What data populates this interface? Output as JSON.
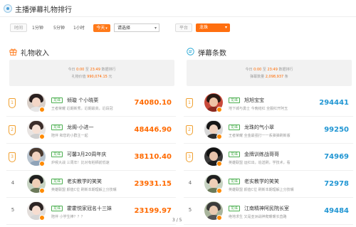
{
  "header": {
    "title": "主播弹幕礼物排行"
  },
  "filters": {
    "time_label": "时间",
    "time_options": [
      "1分钟",
      "5分钟",
      "1小时"
    ],
    "today_label": "今天",
    "select_placeholder": "请选择",
    "platform_label": "平台",
    "platform_value": "龙珠"
  },
  "gifts": {
    "title": "礼物收入",
    "summary_line1": {
      "prefix": "今日 ",
      "t1": "0:00",
      "mid": " 至 ",
      "t2": "23:49",
      "suffix": " 数据排行"
    },
    "summary_line2": {
      "prefix": "礼物价值 ",
      "value": "990,074.15",
      "suffix": " 元"
    },
    "rows": [
      {
        "rank": "1",
        "tag": "龙珠",
        "name": "倾璇 个小晓栗",
        "desc": "王者荣耀 近期新秀，近期最高，近段冠",
        "value": "74080.10"
      },
      {
        "rank": "2",
        "tag": "龙珠",
        "name": "龙阁-小进一",
        "desc": "陪伴 和您的小群主一起",
        "value": "48446.90"
      },
      {
        "rank": "3",
        "tag": "龙珠",
        "name": "可馨3月20周年庆",
        "desc": "炉候大战 三周年！比对有稻栖前低速",
        "value": "38110.40"
      },
      {
        "rank": "4",
        "tag": "龙珠",
        "name": "老实教学的笑笑",
        "desc": "英雄联盟 颜值C位 刷新本期理解上分技嘴",
        "value": "23931.15"
      },
      {
        "rank": "5",
        "tag": "龙珠",
        "name": "霍霍悦家冠名十三妹",
        "desc": "陪伴 小学生棒？？？",
        "value": "23199.97"
      }
    ]
  },
  "danmaku": {
    "title": "弹幕条数",
    "summary_line1": {
      "prefix": "今日 ",
      "t1": "0:00",
      "mid": " 至 ",
      "t2": "23:49",
      "suffix": " 数据排行"
    },
    "summary_line2": {
      "prefix": "弹幕数量 ",
      "value": "2,098,937",
      "suffix": " 条"
    },
    "rows": [
      {
        "rank": "1",
        "tag": "龙珠",
        "name": "旭旭宝宝",
        "desc": "地下城与勇士 今晚结红 全服红开阿玉",
        "value": "294441"
      },
      {
        "rank": "2",
        "tag": "龙珠",
        "name": "龙珠的气小翠",
        "desc": "王者荣耀 全金最强打一一系弹弹刷新版",
        "value": "99250"
      },
      {
        "rank": "3",
        "tag": "龙珠",
        "name": "金牌训练战哥哥",
        "desc": "英雄联盟 运红出，追送刷，学技术，看",
        "value": "74969"
      },
      {
        "rank": "4",
        "tag": "龙珠",
        "name": "老实教学的笑笑",
        "desc": "英雄联盟 颜值C位 刷新本期理解上分技嘴",
        "value": "72978"
      },
      {
        "rank": "5",
        "tag": "龙珠",
        "name": "江南精神阿民院长室",
        "desc": "绝地求生 又是亚洲战神爬暖暖长直路",
        "value": "49484"
      }
    ]
  },
  "pager": {
    "text": "3 / 5"
  }
}
